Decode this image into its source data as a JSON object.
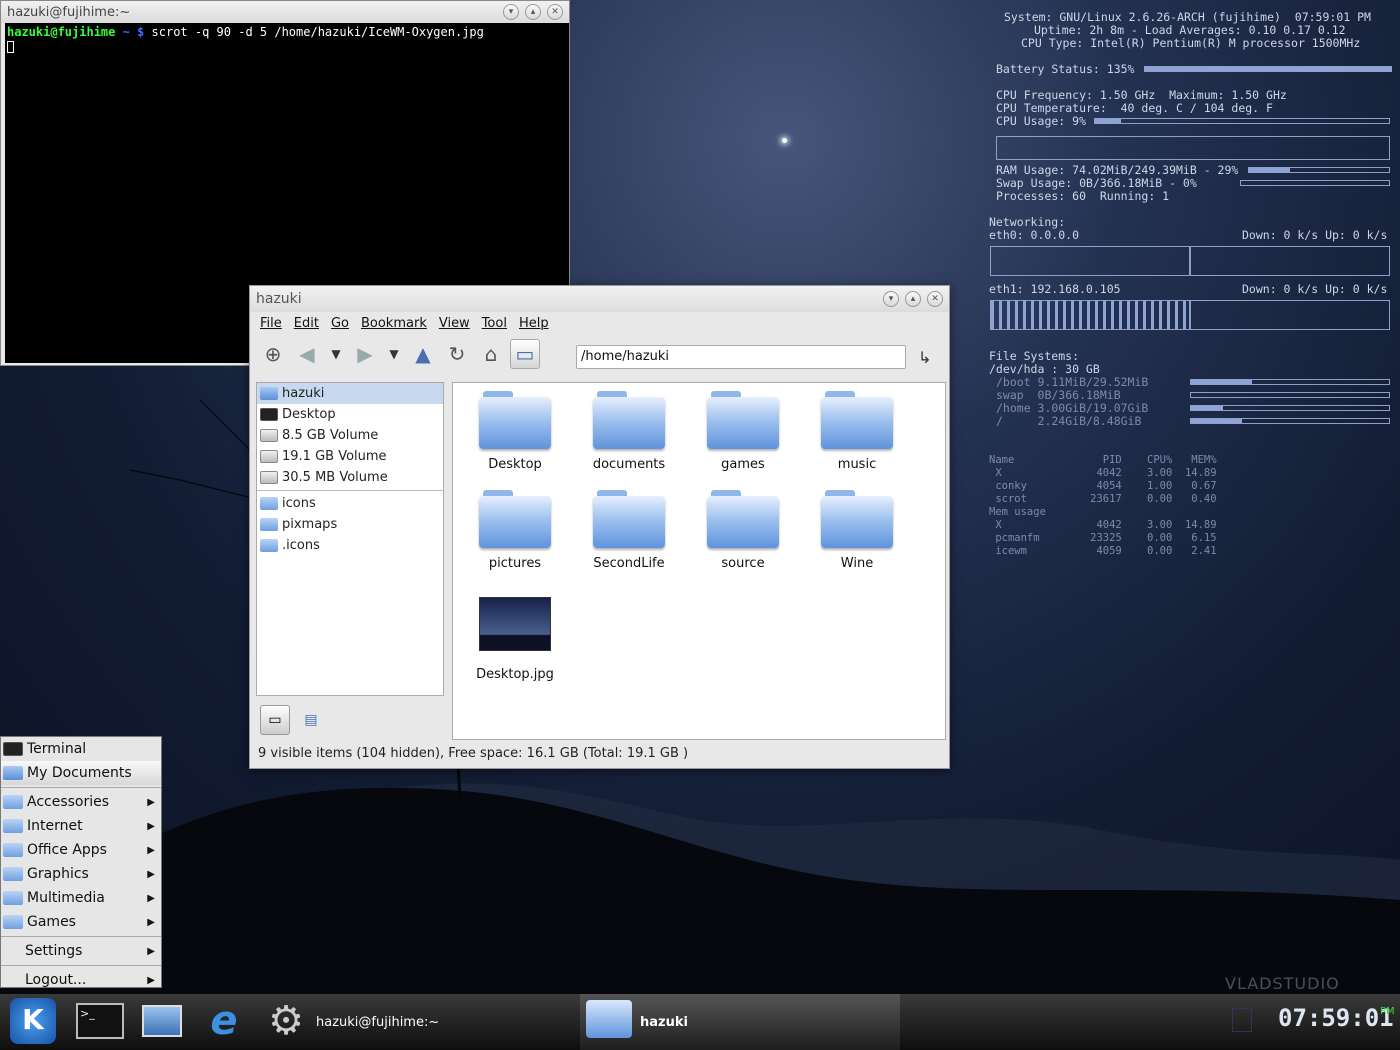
{
  "terminal": {
    "title": "hazuki@fujihime:~",
    "prompt_user": "hazuki@fujihime",
    "prompt_dir": "~ $",
    "command": "scrot -q 90 -d 5 /home/hazuki/IceWM-Oxygen.jpg"
  },
  "filemanager": {
    "title": "hazuki",
    "menu": [
      "File",
      "Edit",
      "Go",
      "Bookmark",
      "View",
      "Tool",
      "Help"
    ],
    "address": "/home/hazuki",
    "sidebar": [
      "hazuki",
      "Desktop",
      "8.5 GB Volume",
      "19.1 GB Volume",
      "30.5 MB Volume",
      "icons",
      "pixmaps",
      ".icons"
    ],
    "items": [
      "Desktop",
      "documents",
      "games",
      "music",
      "pictures",
      "SecondLife",
      "source",
      "Wine",
      "Desktop.jpg"
    ],
    "status": "9 visible items (104 hidden), Free space: 16.1 GB (Total: 19.1 GB )"
  },
  "conky": {
    "system": "System: GNU/Linux 2.6.26-ARCH (fujihime)  07:59:01 PM",
    "uptime": "Uptime: 2h 8m - Load Averages: 0.10 0.17 0.12",
    "cputype": "CPU Type: Intel(R) Pentium(R) M processor 1500MHz",
    "battery": "Battery Status: 135%",
    "battery_level": 1.0,
    "cpufreq": "CPU Frequency: 1.50 GHz  Maximum: 1.50 GHz",
    "cputemp": "CPU Temperature:  40 deg. C / 104 deg. F",
    "cpuusage": "CPU Usage: 9%",
    "cpu_level": 0.09,
    "ram": "RAM Usage: 74.02MiB/249.39MiB - 29%",
    "ram_level": 0.29,
    "swap": "Swap Usage: 0B/366.18MiB - 0%",
    "swap_level": 0,
    "procs": "Processes: 60  Running: 1",
    "net_title": "Networking:",
    "eth0": "eth0: 0.0.0.0",
    "eth0_rate": "Down: 0 k/s Up: 0 k/s",
    "eth1": "eth1: 192.168.0.105",
    "eth1_rate": "Down: 0 k/s Up: 0 k/s",
    "fs_title": "File Systems:",
    "hda": "/dev/hda : 30 GB",
    "fs": [
      {
        "label": "/boot 9.11MiB/29.52MiB",
        "level": 0.31
      },
      {
        "label": "swap  0B/366.18MiB",
        "level": 0
      },
      {
        "label": "/home 3.00GiB/19.07GiB",
        "level": 0.16
      },
      {
        "label": "/     2.24GiB/8.48GiB",
        "level": 0.26
      }
    ],
    "proc_table": "Name              PID    CPU%   MEM%\n X               4042    3.00  14.89\n conky           4054    1.00   0.67\n scrot          23617    0.00   0.40\nMem usage\n X               4042    3.00  14.89\n pcmanfm        23325    0.00   6.15\n icewm           4059    0.00   2.41"
  },
  "startmenu": {
    "items": [
      "Terminal",
      "My Documents",
      "Accessories",
      "Internet",
      "Office Apps",
      "Graphics",
      "Multimedia",
      "Games",
      "Settings",
      "Logout..."
    ]
  },
  "taskbar": {
    "task1": "hazuki@fujihime:~",
    "task2": "hazuki",
    "clock": "07:59:01",
    "ampm": "PM"
  },
  "watermark": "VLADSTUDIO"
}
